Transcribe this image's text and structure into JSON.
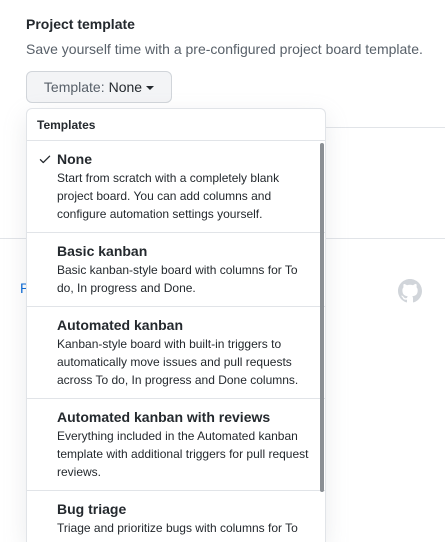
{
  "section": {
    "title": "Project template",
    "description": "Save yourself time with a pre-configured project board template."
  },
  "template_button": {
    "prefix": "Template:",
    "value": "None"
  },
  "dropdown": {
    "header": "Templates",
    "items": [
      {
        "name": "None",
        "desc_lines": [
          "Start from scratch with a completely blank",
          "project board. You can add columns and",
          "configure automation settings yourself."
        ],
        "selected": true
      },
      {
        "name": "Basic kanban",
        "desc_lines": [
          "Basic kanban-style board with columns for To",
          "do, In progress and Done."
        ],
        "selected": false
      },
      {
        "name": "Automated kanban",
        "desc_lines": [
          "Kanban-style board with built-in triggers to",
          "automatically move issues and pull requests",
          "across To do, In progress and Done columns."
        ],
        "selected": false
      },
      {
        "name": "Automated kanban with reviews",
        "desc_lines": [
          "Everything included in the Automated kanban",
          "template with additional triggers for pull request",
          "reviews."
        ],
        "selected": false
      },
      {
        "name": "Bug triage",
        "desc_lines": [
          "Triage and prioritize bugs with columns for To"
        ],
        "selected": false
      }
    ]
  },
  "background": {
    "link_text": "P"
  },
  "icons": {
    "check": "check-icon",
    "caret": "caret-down-icon",
    "logo": "github-mark-icon"
  },
  "colors": {
    "text": "#24292e",
    "muted": "#586069",
    "link": "#0366d6",
    "border": "#e1e4e8"
  }
}
